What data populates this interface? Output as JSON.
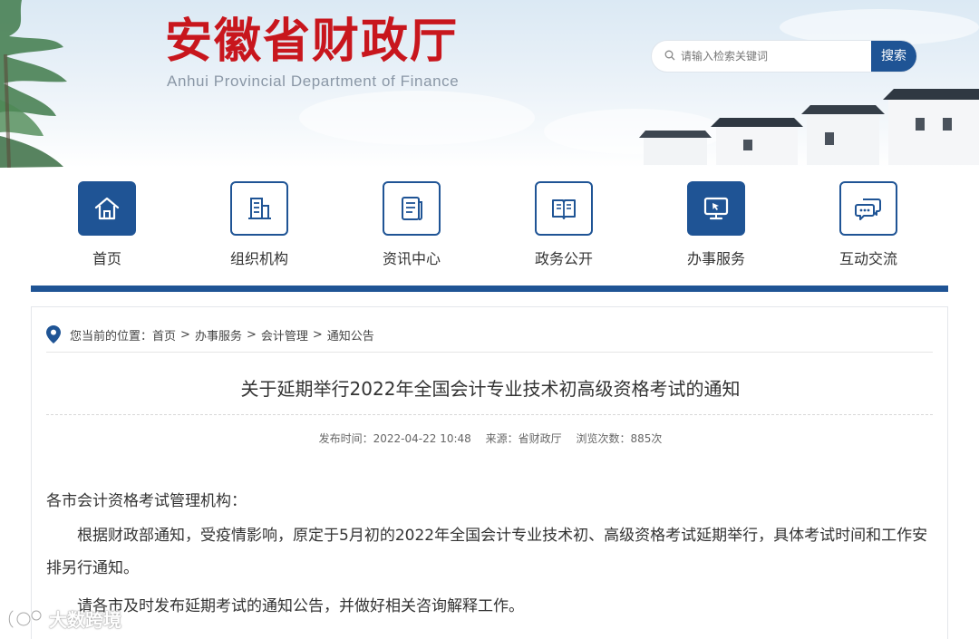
{
  "header": {
    "title": "安徽省财政厅",
    "subtitle": "Anhui Provincial Department of Finance",
    "brand_color": "#c8161d"
  },
  "search": {
    "placeholder": "请输入检索关键词",
    "button_label": "搜索"
  },
  "nav": {
    "accent_color": "#1f5495",
    "items": [
      {
        "label": "首页",
        "icon": "home-icon",
        "active": true
      },
      {
        "label": "组织机构",
        "icon": "building-icon",
        "active": false
      },
      {
        "label": "资讯中心",
        "icon": "news-icon",
        "active": false
      },
      {
        "label": "政务公开",
        "icon": "book-icon",
        "active": false
      },
      {
        "label": "办事服务",
        "icon": "monitor-icon",
        "active": true
      },
      {
        "label": "互动交流",
        "icon": "chat-icon",
        "active": false
      }
    ]
  },
  "breadcrumb": {
    "prefix": "您当前的位置：",
    "items": [
      "首页",
      "办事服务",
      "会计管理",
      "通知公告"
    ],
    "separator": ">"
  },
  "article": {
    "title": "关于延期举行2022年全国会计专业技术初高级资格考试的通知",
    "meta": {
      "published": "发布时间：2022-04-22 10:48",
      "source": "来源：省财政厅",
      "views": "浏览次数：885次"
    },
    "greeting": "各市会计资格考试管理机构：",
    "paragraphs": [
      "根据财政部通知，受疫情影响，原定于5月初的2022年全国会计专业技术初、高级资格考试延期举行，具体考试时间和工作安排另行通知。",
      "请各市及时发布延期考试的通知公告，并做好相关咨询解释工作。"
    ]
  },
  "watermark": {
    "text": "大数跨境"
  }
}
